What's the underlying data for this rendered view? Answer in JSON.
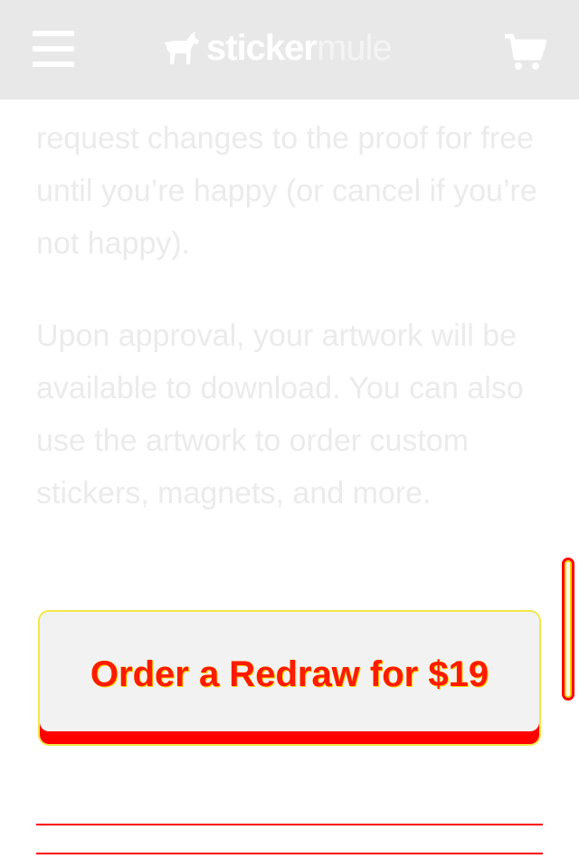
{
  "header": {
    "menu_icon": "hamburger-menu-icon",
    "logo": {
      "bold": "sticker",
      "light": "mule",
      "icon": "mule-logo-icon"
    },
    "cart_icon": "shopping-cart-icon"
  },
  "content": {
    "paragraphs": [
      "request changes to the proof for free until you’re happy (or cancel if you’re not happy).",
      "Upon approval, your artwork will be available to download. You can also use the artwork to order custom stickers, magnets, and more."
    ]
  },
  "cta": {
    "label": "Order a Redraw for $19"
  },
  "colors": {
    "header_bg": "#e8e8e8",
    "cta_accent": "#ff0000",
    "text": "#ebebeb"
  }
}
